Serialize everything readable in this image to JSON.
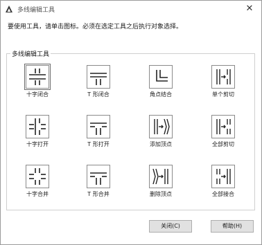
{
  "window": {
    "title": "多线编辑工具",
    "close_glyph": "✕"
  },
  "instruction": "要使用工具，请单击图标。必须在选定工具之后执行对象选择。",
  "group": {
    "label": "多线编辑工具"
  },
  "tools": [
    {
      "label": "十字闭合",
      "icon": "cross-closed-icon"
    },
    {
      "label": "T 形闭合",
      "icon": "tee-closed-icon"
    },
    {
      "label": "角点结合",
      "icon": "corner-joint-icon"
    },
    {
      "label": "单个剪切",
      "icon": "cut-single-icon"
    },
    {
      "label": "十字打开",
      "icon": "cross-open-icon"
    },
    {
      "label": "T 形打开",
      "icon": "tee-open-icon"
    },
    {
      "label": "添加顶点",
      "icon": "add-vertex-icon"
    },
    {
      "label": "全部剪切",
      "icon": "cut-all-icon"
    },
    {
      "label": "十字合并",
      "icon": "cross-merged-icon"
    },
    {
      "label": "T 形合并",
      "icon": "tee-merged-icon"
    },
    {
      "label": "删除顶点",
      "icon": "delete-vertex-icon"
    },
    {
      "label": "全部接合",
      "icon": "weld-all-icon"
    }
  ],
  "buttons": {
    "close_label": "关闭(C)",
    "help_label": "帮助(H)"
  },
  "colors": {
    "border": "#9a9a9a",
    "button_face": "#e1e1e1",
    "icon_stroke": "#222222"
  }
}
